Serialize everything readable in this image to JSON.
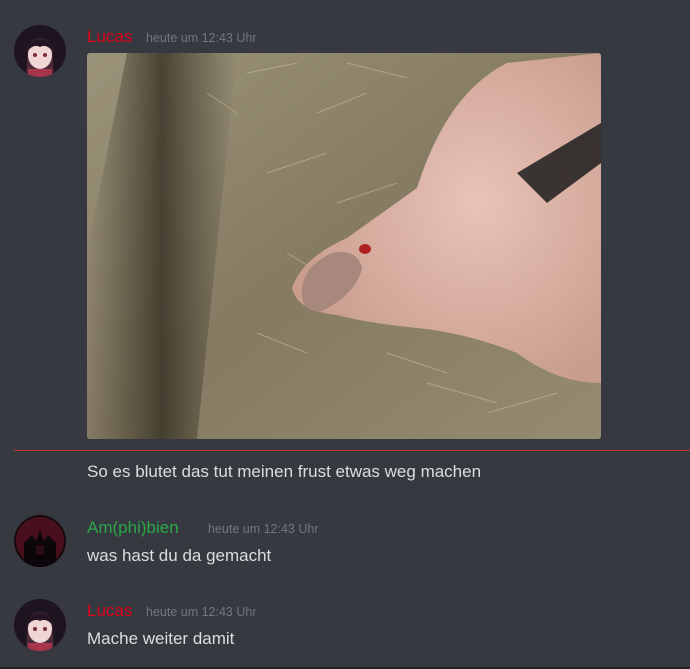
{
  "colors": {
    "background": "#36393f",
    "lucas_name": "#e0001b",
    "amphibien_name": "#2aa84a",
    "timestamp": "#72767d",
    "message_text": "#dcddde",
    "divider": "#c0392b"
  },
  "messages": [
    {
      "author": "Lucas",
      "timestamp": "heute um 12:43 Uhr",
      "attachment": "photo",
      "text": "So es blutet das tut meinen frust etwas weg machen"
    },
    {
      "author": "Am(phi)bien",
      "timestamp": "heute um 12:43 Uhr",
      "text": "was hast du da gemacht"
    },
    {
      "author": "Lucas",
      "timestamp": "heute um 12:43 Uhr",
      "text": "Mache weiter damit"
    }
  ]
}
